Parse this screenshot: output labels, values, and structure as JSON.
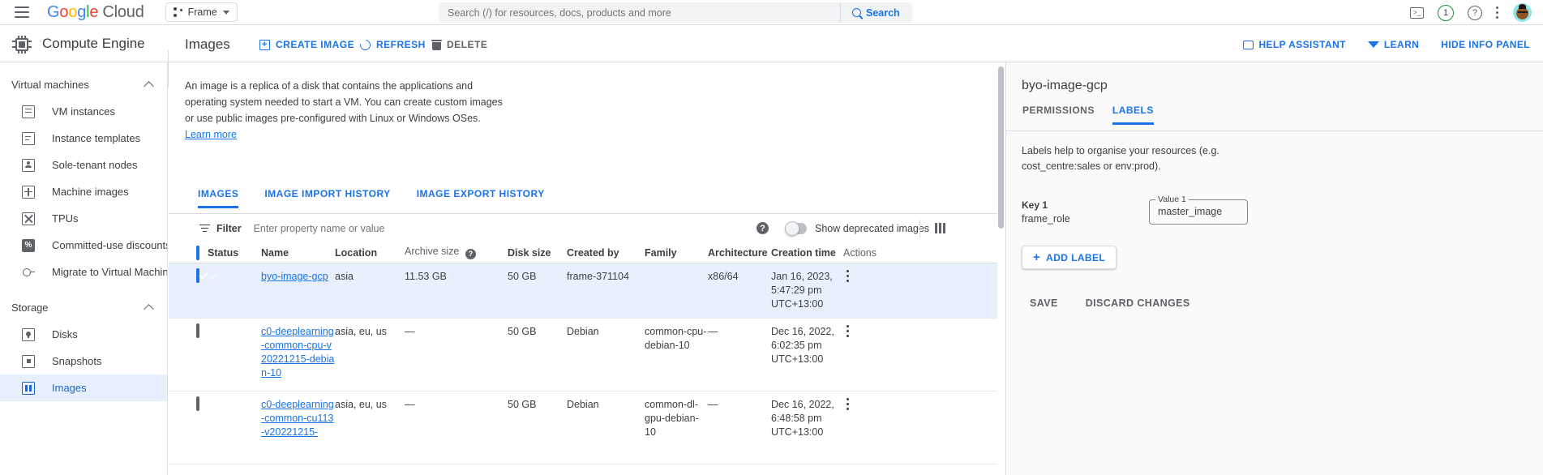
{
  "topbar": {
    "menu_icon": "hamburger-icon",
    "logo": {
      "google": "Google",
      "cloud": "Cloud"
    },
    "project": {
      "label": "Frame",
      "icon": "project-icon"
    },
    "search": {
      "placeholder": "Search (/) for resources, docs, products and more",
      "value": "",
      "button": "Search"
    },
    "terminal_icon": "cloud-shell-icon",
    "notification_count": "1",
    "help_icon": "help-icon",
    "more_icon": "more-vertical-icon",
    "avatar": "user-avatar"
  },
  "secondbar": {
    "product": "Compute Engine",
    "page_title": "Images",
    "actions": [
      {
        "label": "CREATE IMAGE",
        "icon": "create-image-icon"
      },
      {
        "label": "REFRESH",
        "icon": "refresh-icon"
      },
      {
        "label": "DELETE",
        "icon": "trash-icon"
      }
    ],
    "right_actions": [
      {
        "label": "HELP ASSISTANT",
        "icon": "chat-icon"
      },
      {
        "label": "LEARN",
        "icon": "graduation-cap-icon"
      },
      {
        "label": "HIDE INFO PANEL",
        "icon": "none"
      }
    ]
  },
  "sidebar": {
    "sections": [
      {
        "title": "Virtual machines",
        "items": [
          {
            "label": "VM instances",
            "icon": "vm-instance-icon",
            "active": false
          },
          {
            "label": "Instance templates",
            "icon": "instance-template-icon",
            "active": false
          },
          {
            "label": "Sole-tenant nodes",
            "icon": "sole-tenant-node-icon",
            "active": false
          },
          {
            "label": "Machine images",
            "icon": "machine-image-icon",
            "active": false
          },
          {
            "label": "TPUs",
            "icon": "tpu-icon",
            "active": false
          },
          {
            "label": "Committed-use discounts",
            "icon": "percent-icon",
            "active": false
          },
          {
            "label": "Migrate to Virtual Machin...",
            "icon": "migrate-icon",
            "active": false
          }
        ]
      },
      {
        "title": "Storage",
        "items": [
          {
            "label": "Disks",
            "icon": "disk-icon",
            "active": false
          },
          {
            "label": "Snapshots",
            "icon": "snapshot-icon",
            "active": false
          },
          {
            "label": "Images",
            "icon": "image-icon",
            "active": true
          }
        ]
      }
    ]
  },
  "main": {
    "description": "An image is a replica of a disk that contains the applications and operating system needed to start a VM. You can create custom images or use public images pre-configured with Linux or Windows OSes. ",
    "learn_more": "Learn more",
    "tabs": [
      {
        "label": "IMAGES",
        "active": true
      },
      {
        "label": "IMAGE IMPORT HISTORY",
        "active": false
      },
      {
        "label": "IMAGE EXPORT HISTORY",
        "active": false
      }
    ],
    "filter": {
      "label": "Filter",
      "placeholder": "Enter property name or value",
      "value": ""
    },
    "help_icon": "help-circle-icon",
    "deprecated_toggle": {
      "label": "Show deprecated images",
      "on": false
    },
    "column_button": "column-display-options-icon",
    "table": {
      "columns": [
        "Status",
        "Name",
        "Location",
        "Archive size",
        "Disk size",
        "Created by",
        "Family",
        "Architecture",
        "Creation time",
        "Actions"
      ],
      "rows": [
        {
          "checked": true,
          "status": "ok",
          "name": "byo-image-gcp",
          "location": "asia",
          "archive_size": "11.53 GB",
          "disk_size": "50 GB",
          "created_by": "frame-371104",
          "family": "",
          "architecture": "x86/64",
          "creation_time": "Jan 16, 2023, 5:47:29 pm UTC+13:00"
        },
        {
          "checked": false,
          "status": "ok",
          "name": "c0-deeplearning-common-cpu-v20221215-debian-10",
          "location": "asia, eu, us",
          "archive_size": "—",
          "disk_size": "50 GB",
          "created_by": "Debian",
          "family": "common-cpu-debian-10",
          "architecture": "—",
          "creation_time": "Dec 16, 2022, 6:02:35 pm UTC+13:00"
        },
        {
          "checked": false,
          "status": "ok",
          "name": "c0-deeplearning-common-cu113-v20221215-",
          "location": "asia, eu, us",
          "archive_size": "—",
          "disk_size": "50 GB",
          "created_by": "Debian",
          "family": "common-dl-gpu-debian-10",
          "architecture": "—",
          "creation_time": "Dec 16, 2022, 6:48:58 pm UTC+13:00"
        }
      ]
    }
  },
  "info_panel": {
    "title": "byo-image-gcp",
    "tabs": [
      {
        "label": "PERMISSIONS",
        "active": false
      },
      {
        "label": "LABELS",
        "active": true
      }
    ],
    "help_text": "Labels help to organise your resources (e.g. cost_centre:sales or env:prod).",
    "key_caption": "Key 1",
    "key_value": "frame_role",
    "value_caption": "Value 1",
    "value_value": "master_image",
    "add_label": "ADD LABEL",
    "save": "SAVE",
    "discard": "DISCARD CHANGES"
  },
  "colors": {
    "accent": "#1a73e8",
    "success": "#1e8e3e",
    "selected_row": "#e8f0fe",
    "panel_bg": "#fafafa",
    "border": "#dadce0"
  }
}
